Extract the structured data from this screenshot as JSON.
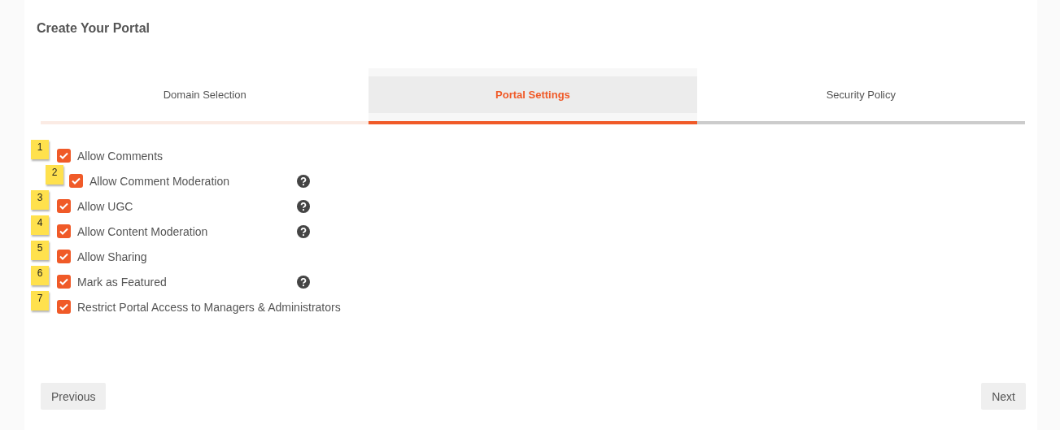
{
  "title": "Create Your Portal",
  "steps": [
    {
      "label": "Domain Selection",
      "selected": false,
      "completed": true
    },
    {
      "label": "Portal Settings",
      "selected": true,
      "completed": false
    },
    {
      "label": "Security Policy",
      "selected": false,
      "completed": false
    }
  ],
  "options": [
    {
      "badge": "1",
      "label": "Allow Comments",
      "checked": true,
      "help": false,
      "children": [
        {
          "badge": "2",
          "label": "Allow Comment Moderation",
          "checked": true,
          "help": true
        }
      ]
    },
    {
      "badge": "3",
      "label": "Allow UGC",
      "checked": true,
      "help": true
    },
    {
      "badge": "4",
      "label": "Allow Content Moderation",
      "checked": true,
      "help": true
    },
    {
      "badge": "5",
      "label": "Allow Sharing",
      "checked": true,
      "help": false
    },
    {
      "badge": "6",
      "label": "Mark as Featured",
      "checked": true,
      "help": true
    },
    {
      "badge": "7",
      "label": "Restrict Portal Access to Managers & Administrators",
      "checked": true,
      "help": false
    }
  ],
  "buttons": {
    "previous": "Previous",
    "next": "Next"
  }
}
